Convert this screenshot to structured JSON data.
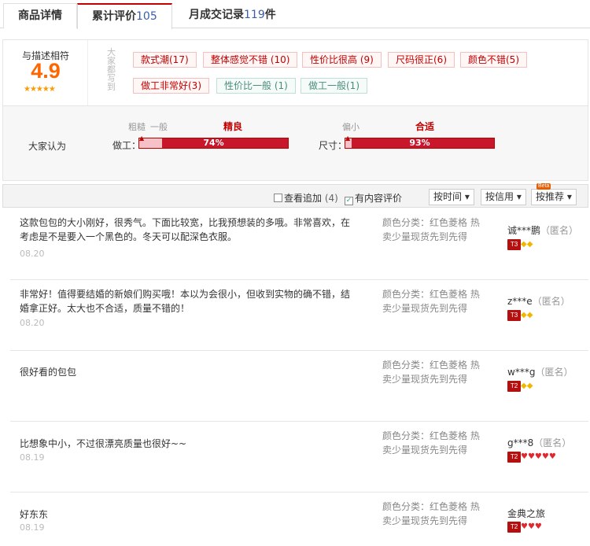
{
  "tabs": [
    {
      "label": "商品详情",
      "count": ""
    },
    {
      "label": "累计评价",
      "count": "105"
    },
    {
      "label": "月成交记录",
      "count": "119",
      "suffix": "件"
    }
  ],
  "score": {
    "label": "与描述相符",
    "value": "4.9",
    "stars": "★★★★★"
  },
  "tag_group_label": "大家都写到",
  "tags": [
    {
      "label": "款式潮(17)",
      "type": "pos"
    },
    {
      "label": "整体感觉不错 (10)",
      "type": "pos"
    },
    {
      "label": "性价比很高 (9)",
      "type": "pos"
    },
    {
      "label": "尺码很正(6)",
      "type": "pos"
    },
    {
      "label": "颜色不错(5)",
      "type": "pos"
    },
    {
      "label": "做工非常好(3)",
      "type": "pos"
    },
    {
      "label": "性价比一般 (1)",
      "type": "neg"
    },
    {
      "label": "做工一般(1)",
      "type": "neg"
    }
  ],
  "opinion": {
    "label": "大家认为",
    "bars": [
      {
        "name": "做工：",
        "low1": "粗糙",
        "low2": "一般",
        "top": "精良",
        "pct_text": "74%",
        "pct": 74
      },
      {
        "name": "尺寸：",
        "low1": "偏小",
        "low2": "",
        "top": "合适",
        "pct_text": "93%",
        "pct": 93
      }
    ]
  },
  "filter": {
    "follow_label": "查看追加",
    "follow_count": "(4)",
    "follow_checked": false,
    "content_label": "有内容评价",
    "content_checked": true,
    "sort_time": "按时间",
    "sort_credit": "按信用",
    "sort_recommend": "按推荐",
    "beta": "Beta"
  },
  "reviews": [
    {
      "text": "这款包包的大小刚好，很秀气。下面比较宽，比我预想装的多哦。非常喜欢，在考虑是不是要入一个黑色的。冬天可以配深色衣服。",
      "date": "08.20",
      "sku": "颜色分类：红色菱格 热卖少量现货先到先得",
      "user": "诚***鹏",
      "anon": "（匿名）",
      "level": "T3",
      "gems": "◆◆",
      "gem_color": "gold"
    },
    {
      "text": "非常好！值得要结婚的新娘们购买哦！本以为会很小，但收到实物的确不错，结婚拿正好。太大也不合适，质量不错的！",
      "date": "08.20",
      "sku": "颜色分类：红色菱格 热卖少量现货先到先得",
      "user": "z***e",
      "anon": "（匿名）",
      "level": "T3",
      "gems": "◆◆",
      "gem_color": "gold"
    },
    {
      "text": "很好看的包包",
      "date": "",
      "sku": "颜色分类：红色菱格 热卖少量现货先到先得",
      "user": "w***g",
      "anon": "（匿名）",
      "level": "T2",
      "gems": "◆◆",
      "gem_color": "gold"
    },
    {
      "text": "比想象中小，不过很漂亮质量也很好~~",
      "date": "08.19",
      "sku": "颜色分类：红色菱格 热卖少量现货先到先得",
      "user": "g***8",
      "anon": "（匿名）",
      "level": "T2",
      "gems": "♥♥♥♥♥",
      "gem_color": "red"
    },
    {
      "text": "好东东",
      "date": "08.19",
      "sku": "颜色分类：红色菱格 热卖少量现货先到先得",
      "user": "金典之旅",
      "anon": "",
      "level": "T2",
      "gems": "♥♥♥",
      "gem_color": "red"
    }
  ]
}
